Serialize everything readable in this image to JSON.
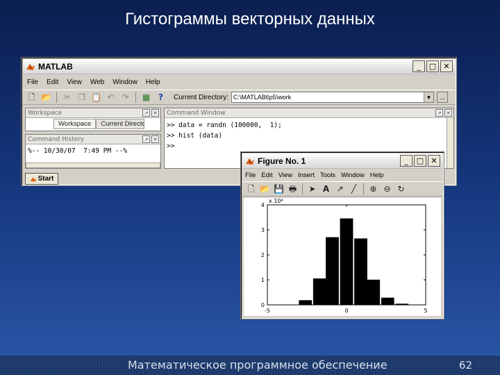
{
  "slide": {
    "title": "Гистограммы векторных данных",
    "footer": "Математическое программное обеспечение",
    "page_number": "62"
  },
  "matlab": {
    "window_title": "MATLAB",
    "menu": [
      "File",
      "Edit",
      "View",
      "Web",
      "Window",
      "Help"
    ],
    "toolbar_icons": [
      "new-file-icon",
      "open-folder-icon",
      "cut-icon",
      "copy-icon",
      "paste-icon",
      "undo-icon",
      "redo-icon",
      "simulink-icon",
      "help-icon"
    ],
    "current_directory_label": "Current Directory:",
    "current_directory_value": "C:\\MATLAB6p5\\work",
    "browse_label": "...",
    "workspace_panel_title": "Workspace",
    "workspace_tabs": [
      "Workspace",
      "Current Directory"
    ],
    "command_history_title": "Command History",
    "command_history_entry": "%-- 10/30/07  7:49 PM --%",
    "command_window_title": "Command Window",
    "command_lines": [
      ">> data = randn (100000,  1);",
      ">> hist (data)",
      ">>"
    ],
    "start_label": "Start"
  },
  "figure": {
    "window_title": "Figure No. 1",
    "menu": [
      "File",
      "Edit",
      "View",
      "Insert",
      "Tools",
      "Window",
      "Help"
    ],
    "toolbar_icons": [
      "new-figure-icon",
      "open-icon",
      "save-icon",
      "print-icon",
      "pointer-arrow-icon",
      "insert-text-icon",
      "insert-arrow-icon",
      "insert-line-icon",
      "zoom-in-icon",
      "zoom-out-icon",
      "rotate-icon"
    ],
    "exponent_label": "x 10⁴"
  },
  "chart_data": {
    "type": "bar",
    "title": "",
    "xlabel": "",
    "ylabel": "",
    "x": [
      -4.3,
      -3.5,
      -2.6,
      -1.7,
      -0.9,
      0.0,
      0.9,
      1.7,
      2.6,
      3.5
    ],
    "values": [
      0.0003,
      0.0035,
      0.18,
      1.05,
      2.7,
      3.45,
      2.65,
      1.0,
      0.28,
      0.04
    ],
    "ylim": [
      0,
      4
    ],
    "xlim": [
      -5,
      5
    ],
    "yticks": [
      "0",
      "1",
      "2",
      "3",
      "4"
    ],
    "xticks": [
      "-5",
      "0",
      "5"
    ],
    "bar_color": "#000000",
    "grid": false
  }
}
